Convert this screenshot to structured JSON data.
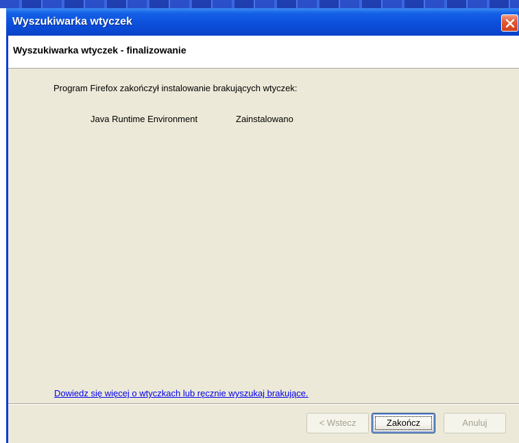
{
  "window": {
    "title": "Wyszukiwarka wtyczek"
  },
  "header": {
    "title": "Wyszukiwarka wtyczek - finalizowanie"
  },
  "content": {
    "intro_text": "Program Firefox zakończył instalowanie brakujących wtyczek:",
    "plugins": [
      {
        "name": "Java Runtime Environment",
        "status": "Zainstalowano"
      }
    ],
    "help_link": "Dowiedz się więcej o wtyczkach lub ręcznie wyszukaj brakujące."
  },
  "buttons": {
    "back": "< Wstecz",
    "finish": "Zakończ",
    "cancel": "Anuluj"
  },
  "colors": {
    "title_bar": "#0a47d0",
    "client_bg": "#ece9d8",
    "link": "#0000ee",
    "close_button": "#e45a35"
  }
}
